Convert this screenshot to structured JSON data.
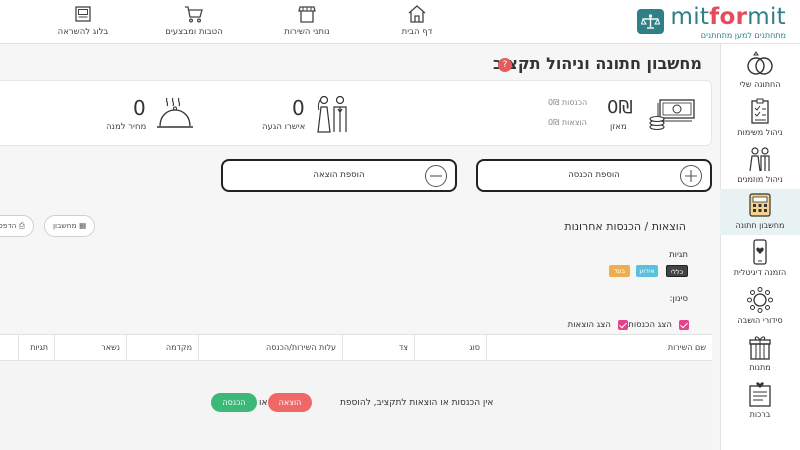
{
  "brand": {
    "name_prefix": "mit",
    "name_middle": "for",
    "name_suffix": "mit",
    "tagline": "מתחתנים למען מתחתנים",
    "accent": "#2f7f86",
    "accent_secondary": "#e64b5b"
  },
  "nav": {
    "home": "דף הבית",
    "services": "נותני השירות",
    "deals": "הטבות ומבצעים",
    "blog": "בלוג להשראה"
  },
  "sidebar": {
    "items": [
      {
        "label": "החתונה שלי",
        "icon": "rings-icon"
      },
      {
        "label": "ניהול משימות",
        "icon": "checklist-icon"
      },
      {
        "label": "ניהול מוזמנים",
        "icon": "guests-icon"
      },
      {
        "label": "מחשבון חתונה",
        "icon": "calculator-icon"
      },
      {
        "label": "הזמנה דיגיטלית",
        "icon": "digital-invite-icon"
      },
      {
        "label": "סידורי הושבה",
        "icon": "seating-icon"
      },
      {
        "label": "מתנות",
        "icon": "gift-icon"
      },
      {
        "label": "ברכות",
        "icon": "greetings-icon"
      }
    ]
  },
  "page": {
    "title": "מחשבון חתונה וניהול תקציב",
    "help_badge": "?"
  },
  "summary": {
    "balance": "0₪",
    "balance_label": "מאזן",
    "income_line": "הכנסות 0₪",
    "expense_line": "הוצאות 0₪",
    "rsvp_value": "0",
    "rsvp_label": "אישרו הגעה",
    "per_plate_value": "0",
    "per_plate_label": "מחיר למנה"
  },
  "actions": {
    "add_income": "הוספת הכנסה",
    "add_expense": "הוספת הוצאה"
  },
  "tools": {
    "calculator": "מחשבון",
    "print": "הדפסה"
  },
  "recent": {
    "title": "הוצאות / הכנסות אחרונות",
    "tags_heading": "תגיות",
    "tags": [
      {
        "label": "כללי",
        "color": "#444444"
      },
      {
        "label": "אירוע",
        "color": "#5bc0de"
      },
      {
        "label": "בעד",
        "color": "#f0ad4e"
      }
    ],
    "filter_heading": "סינון:",
    "filter_income": "הצג הכנסות",
    "filter_expense": "הצג הוצאות"
  },
  "table": {
    "columns": [
      "שם השירות",
      "סוג",
      "צד",
      "עלות השירות/הכנסה",
      "מקדמה",
      "נשאר",
      "תגיות"
    ],
    "empty_message": "אין הכנסות או הוצאות לתקציב, להוספת",
    "or": "או",
    "add_expense_pill": "הוצאה",
    "add_income_pill": "הכנסה",
    "expense_color": "#ef6767",
    "income_color": "#3cb878"
  }
}
